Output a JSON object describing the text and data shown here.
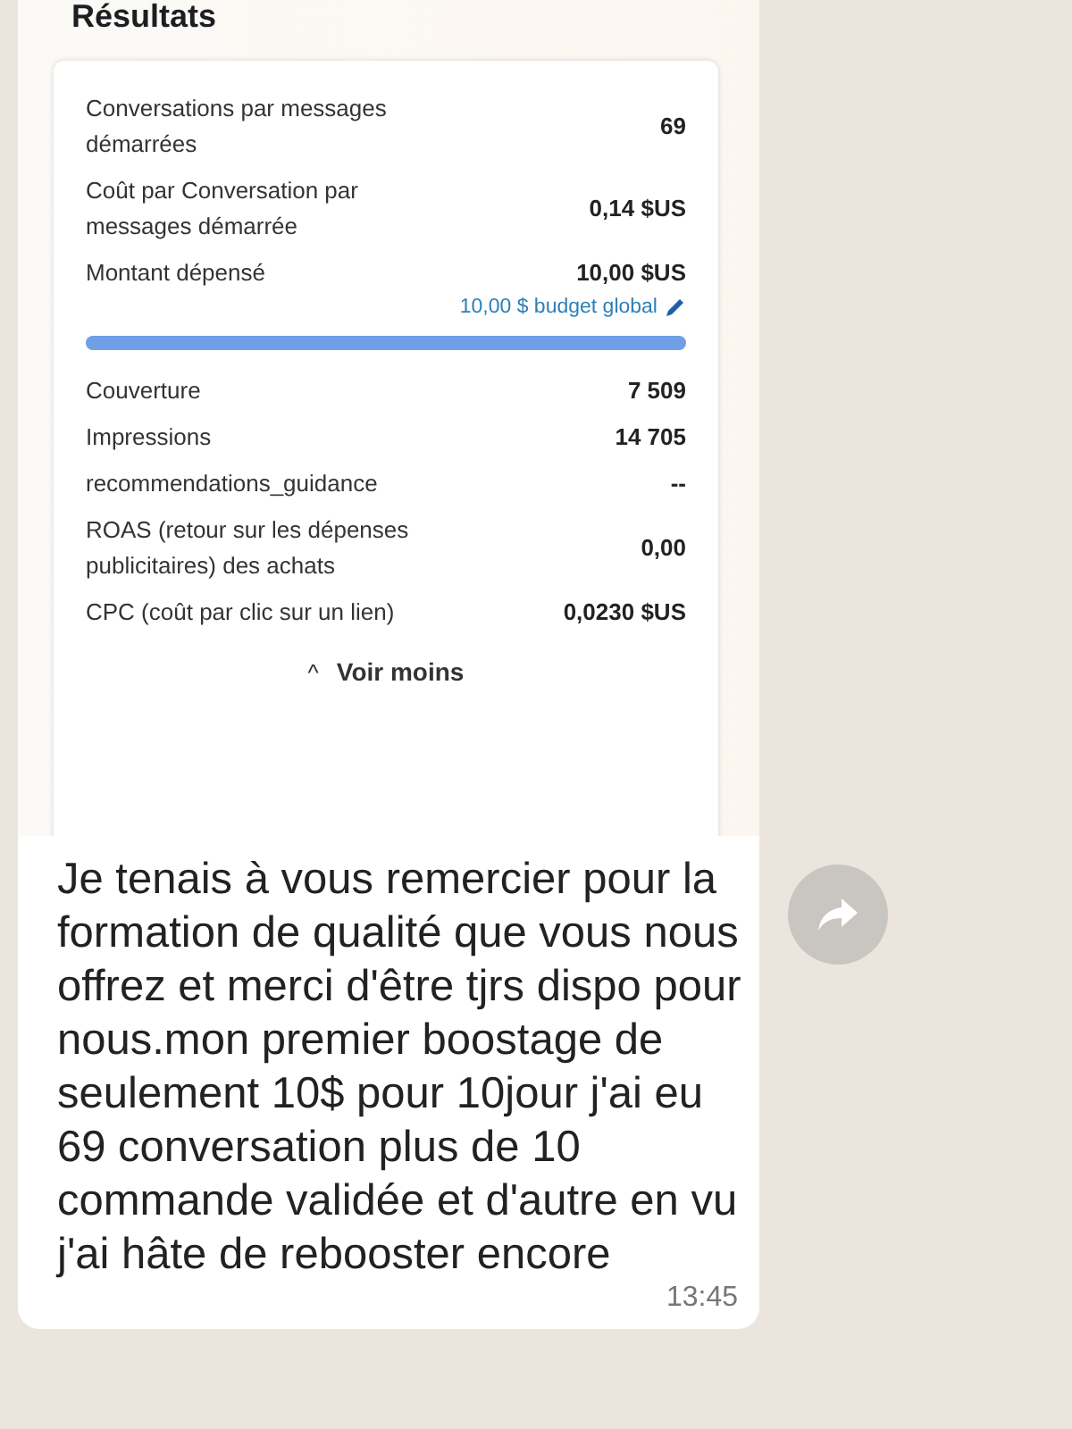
{
  "shared_screenshot": {
    "title": "Résultats",
    "metrics": [
      {
        "label": "Conversations par messages démarrées",
        "value": "69"
      },
      {
        "label": "Coût par Conversation par messages démarrée",
        "value": "0,14 $US"
      },
      {
        "label": "Montant dépensé",
        "value": "10,00 $US"
      }
    ],
    "budget": {
      "label": "10,00 $ budget global",
      "level": 1
    },
    "more_metrics": [
      {
        "label": "Couverture",
        "value": "7 509"
      },
      {
        "label": "Impressions",
        "value": "14 705"
      },
      {
        "label": "recommendations_guidance",
        "value": "--"
      },
      {
        "label": "ROAS (retour sur les dépenses publicitaires) des achats",
        "value": "0,00"
      },
      {
        "label": "CPC (coût par clic sur un lien)",
        "value": "0,0230 $US"
      }
    ],
    "toggle": {
      "icon": "^",
      "label": "Voir moins"
    }
  },
  "message": {
    "text": "Je tenais à vous remercier pour la formation de qualité que vous nous offrez et merci d'être tjrs dispo pour nous.mon premier boostage de seulement 10$ pour 10jour j'ai eu 69 conversation plus de 10 commande validée et d'autre en vu j'ai hâte de rebooster encore",
    "time": "13:45"
  }
}
